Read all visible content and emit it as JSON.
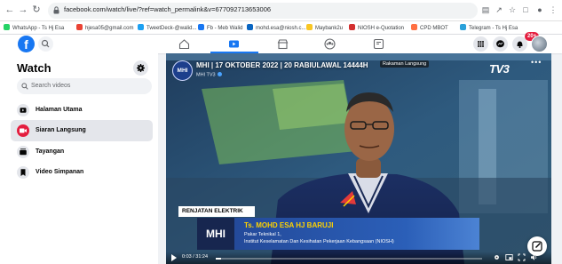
{
  "browser": {
    "url": "facebook.com/watch/live/?ref=watch_permalink&v=677092713653006",
    "bookmarks": [
      {
        "label": "WhatsApp - Ts Hj Esa",
        "color": "#25d366"
      },
      {
        "label": "hjesa05@gmail.com",
        "color": "#ea4335"
      },
      {
        "label": "TweetDeck-@walid...",
        "color": "#1da1f2"
      },
      {
        "label": "Fb - Meb Walid",
        "color": "#1877f2"
      },
      {
        "label": "mohd.esa@niosh.c...",
        "color": "#0a66c2"
      },
      {
        "label": "Maybank2u",
        "color": "#f9c623"
      },
      {
        "label": "NIOSH e-Quotation",
        "color": "#d32f2f"
      },
      {
        "label": "CPD MBOT",
        "color": "#ff7043"
      },
      {
        "label": "Telegram - Ts Hj Esa",
        "color": "#2aa1da"
      }
    ]
  },
  "header": {
    "logo_letter": "f",
    "notification_count": "20+"
  },
  "sidebar": {
    "title": "Watch",
    "search_placeholder": "Search videos",
    "items": [
      {
        "label": "Halaman Utama",
        "icon": "home-play-icon",
        "active": false
      },
      {
        "label": "Siaran Langsung",
        "icon": "live-icon",
        "active": true
      },
      {
        "label": "Tayangan",
        "icon": "shows-icon",
        "active": false
      },
      {
        "label": "Video Simpanan",
        "icon": "bookmark-icon",
        "active": false
      }
    ]
  },
  "video": {
    "channel_logo": "MHI",
    "title": "MHI | 17 OKTOBER 2022 | 20 RABIULAWAL 14444H",
    "badge": "Rakaman Langsung",
    "subtitle": "MHI TV3",
    "corner_logo": "TV3",
    "segment_label": "RENJATAN ELEKTRIK",
    "lower_logo": "MHI",
    "guest_name": "Ts. MOHD ESA HJ BARUJI",
    "guest_role": "Pakar Teknikal 1,",
    "guest_org": "Institut Keselamatan Dan Kesihatan Pekerjaan Kebangsaan (NIOSH)",
    "time": "0:03 / 31:24",
    "progress": 0.02
  }
}
